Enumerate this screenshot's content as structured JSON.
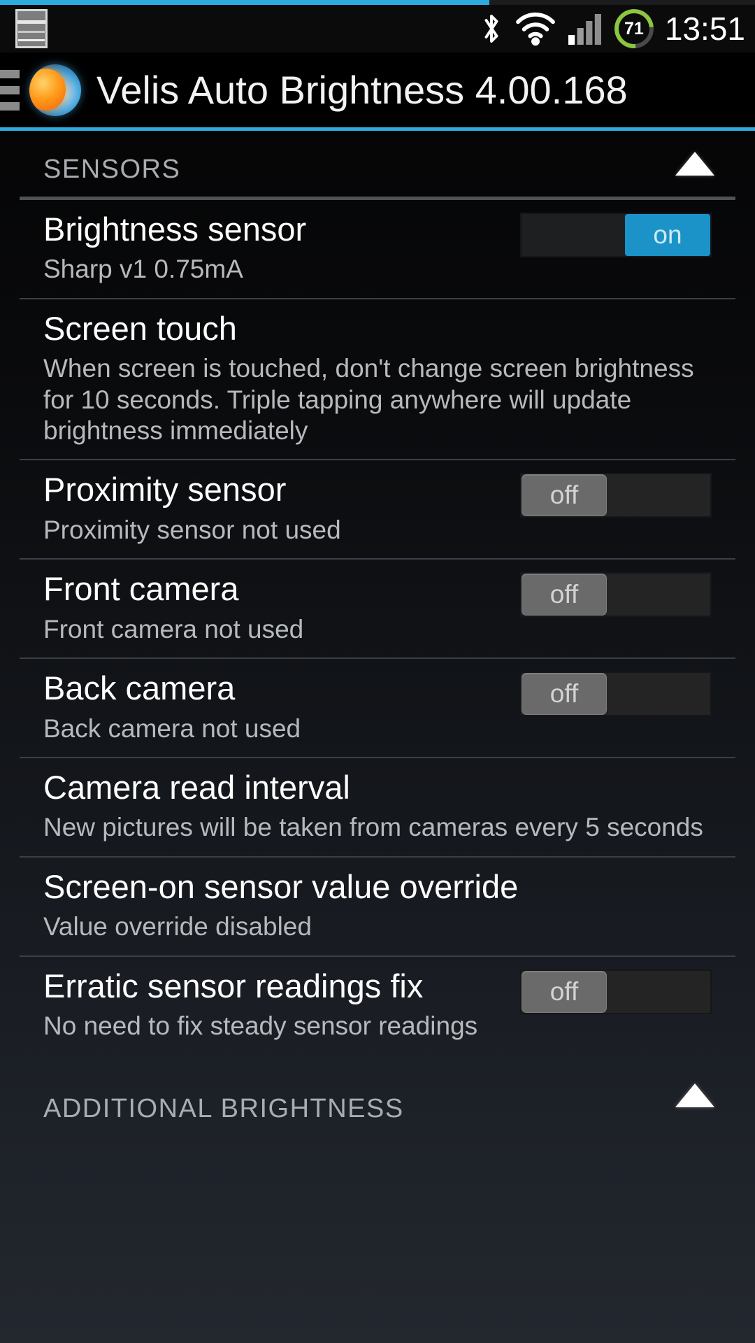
{
  "statusbar": {
    "screenshot_icon": "screenshot-icon",
    "bluetooth_icon": "bluetooth-icon",
    "wifi_icon": "wifi-icon",
    "signal_icon": "cell-signal-icon",
    "battery_level": "71",
    "time": "13:51"
  },
  "titlebar": {
    "menu_icon": "hamburger-menu-icon",
    "app_icon": "velis-sun-earth-icon",
    "title": "Velis Auto Brightness 4.00.168"
  },
  "accent_color": "#2eaade",
  "toggle_on_color": "#1b93c8",
  "toggle_off_color": "#6a6a6a",
  "sections": [
    {
      "header": "SENSORS",
      "collapse_icon": "collapse-up-arrow-icon",
      "rows": [
        {
          "title": "Brightness sensor",
          "desc": "Sharp v1 0.75mA",
          "toggle": "on",
          "toggle_label": "on"
        },
        {
          "title": "Screen touch",
          "desc": "When screen is touched, don't change screen brightness for 10 seconds. Triple tapping anywhere will update brightness immediately",
          "toggle": null
        },
        {
          "title": "Proximity sensor",
          "desc": "Proximity sensor not used",
          "toggle": "off",
          "toggle_label": "off"
        },
        {
          "title": "Front camera",
          "desc": "Front camera not used",
          "toggle": "off",
          "toggle_label": "off"
        },
        {
          "title": "Back camera",
          "desc": "Back camera not used",
          "toggle": "off",
          "toggle_label": "off"
        },
        {
          "title": "Camera read interval",
          "desc": "New pictures will be taken from cameras every 5 seconds",
          "toggle": null
        },
        {
          "title": "Screen-on sensor value override",
          "desc": "Value override disabled",
          "toggle": null
        },
        {
          "title": "Erratic sensor readings fix",
          "desc": "No need to fix steady sensor readings",
          "toggle": "off",
          "toggle_label": "off",
          "inline": true
        }
      ]
    },
    {
      "header": "ADDITIONAL BRIGHTNESS",
      "collapse_icon": "collapse-up-arrow-icon",
      "rows": []
    }
  ]
}
